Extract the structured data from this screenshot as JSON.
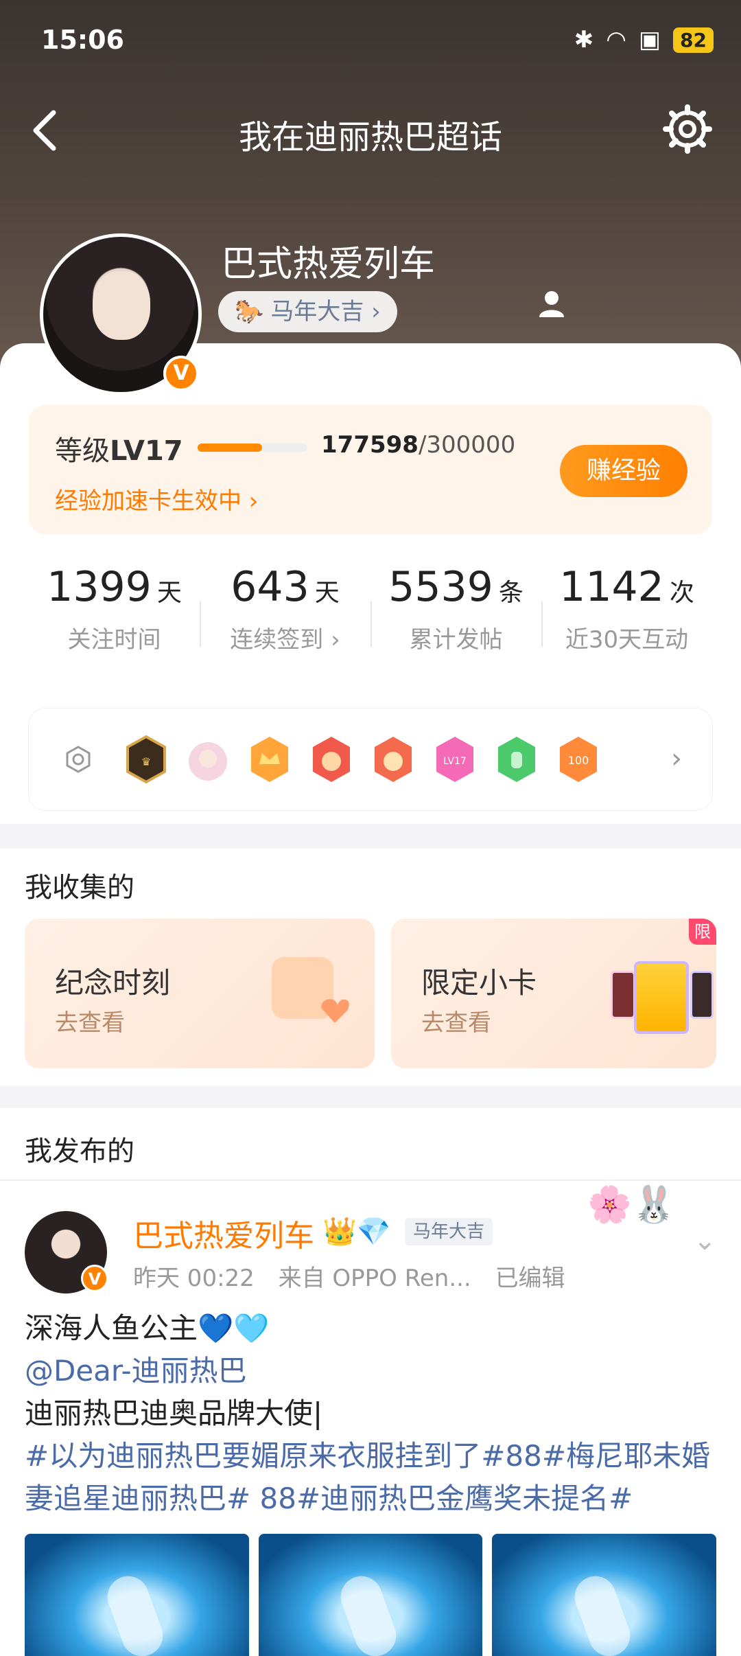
{
  "status_bar": {
    "time": "15:06",
    "battery": "82"
  },
  "nav": {
    "title": "我在迪丽热巴超话"
  },
  "profile": {
    "name": "巴式热爱列车",
    "tag": "马年大吉 ›",
    "verified_mark": "V"
  },
  "level": {
    "label": "等级",
    "value": "LV17",
    "exp_current": "177598",
    "exp_total": "/300000",
    "progress": 0.59,
    "boost_text": "经验加速卡生效中 ›",
    "earn_button": "赚经验"
  },
  "stats": [
    {
      "num": "1399",
      "unit": "天",
      "label": "关注时间"
    },
    {
      "num": "643",
      "unit": "天",
      "label": "连续签到 ›"
    },
    {
      "num": "5539",
      "unit": "条",
      "label": "累计发帖"
    },
    {
      "num": "1142",
      "unit": "次",
      "label": "近30天互动"
    }
  ],
  "badges": [
    "super-badge",
    "character-badge",
    "crown-badge",
    "tiger-badge",
    "tiger2-badge",
    "lv17-badge",
    "hand-badge",
    "100days-badge"
  ],
  "collect": {
    "title": "我收集的",
    "cards": [
      {
        "title": "纪念时刻",
        "sub": "去查看"
      },
      {
        "title": "限定小卡",
        "sub": "去查看",
        "tag": "限"
      }
    ]
  },
  "posts": {
    "title": "我发布的",
    "item": {
      "name": "巴式热爱列车",
      "tag": "马年大吉",
      "time": "昨天 00:22",
      "source": "来自 OPPO Ren...",
      "edited": "已编辑",
      "line1": "深海人鱼公主💙🩵",
      "mention": "@Dear-迪丽热巴",
      "line3": "迪丽热巴迪奥品牌大使|",
      "hashtags": "#以为迪丽热巴要媚原来衣服挂到了#88#梅尼耶未婚妻追星迪丽热巴# 88#迪丽热巴金鹰奖未提名#"
    }
  },
  "colors": {
    "accent": "#ff8200",
    "link": "#4a6aa8"
  }
}
